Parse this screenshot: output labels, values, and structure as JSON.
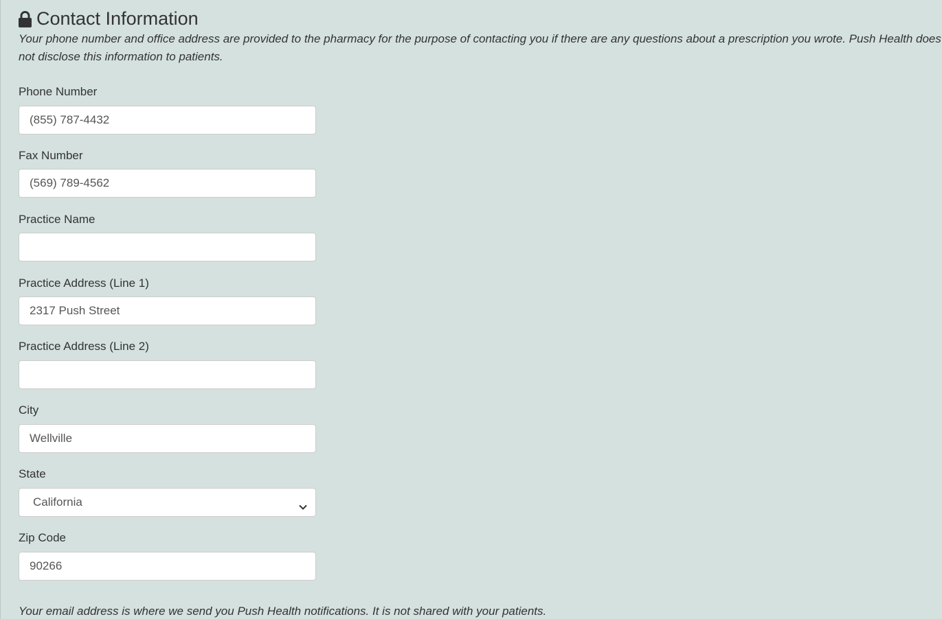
{
  "section": {
    "title": "Contact Information",
    "title_icon": "lock-icon",
    "intro": "Your phone number and office address are provided to the pharmacy for the purpose of contacting you if there are any questions about a prescription you wrote. Push Health does not disclose this information to patients."
  },
  "fields": {
    "phone": {
      "label": "Phone Number",
      "value": "(855) 787-4432"
    },
    "fax": {
      "label": "Fax Number",
      "value": "(569) 789-4562"
    },
    "practice_name": {
      "label": "Practice Name",
      "value": ""
    },
    "address1": {
      "label": "Practice Address (Line 1)",
      "value": "2317 Push Street"
    },
    "address2": {
      "label": "Practice Address (Line 2)",
      "value": ""
    },
    "city": {
      "label": "City",
      "value": "Wellville"
    },
    "state": {
      "label": "State",
      "selected": "California",
      "icon": "chevron-down-icon"
    },
    "zip": {
      "label": "Zip Code",
      "value": "90266"
    }
  },
  "email_note": "Your email address is where we send you Push Health notifications. It is not shared with your patients.",
  "colors": {
    "background": "#d4e1df",
    "text": "#333333",
    "input_border": "#cccccc",
    "input_text": "#555555"
  }
}
